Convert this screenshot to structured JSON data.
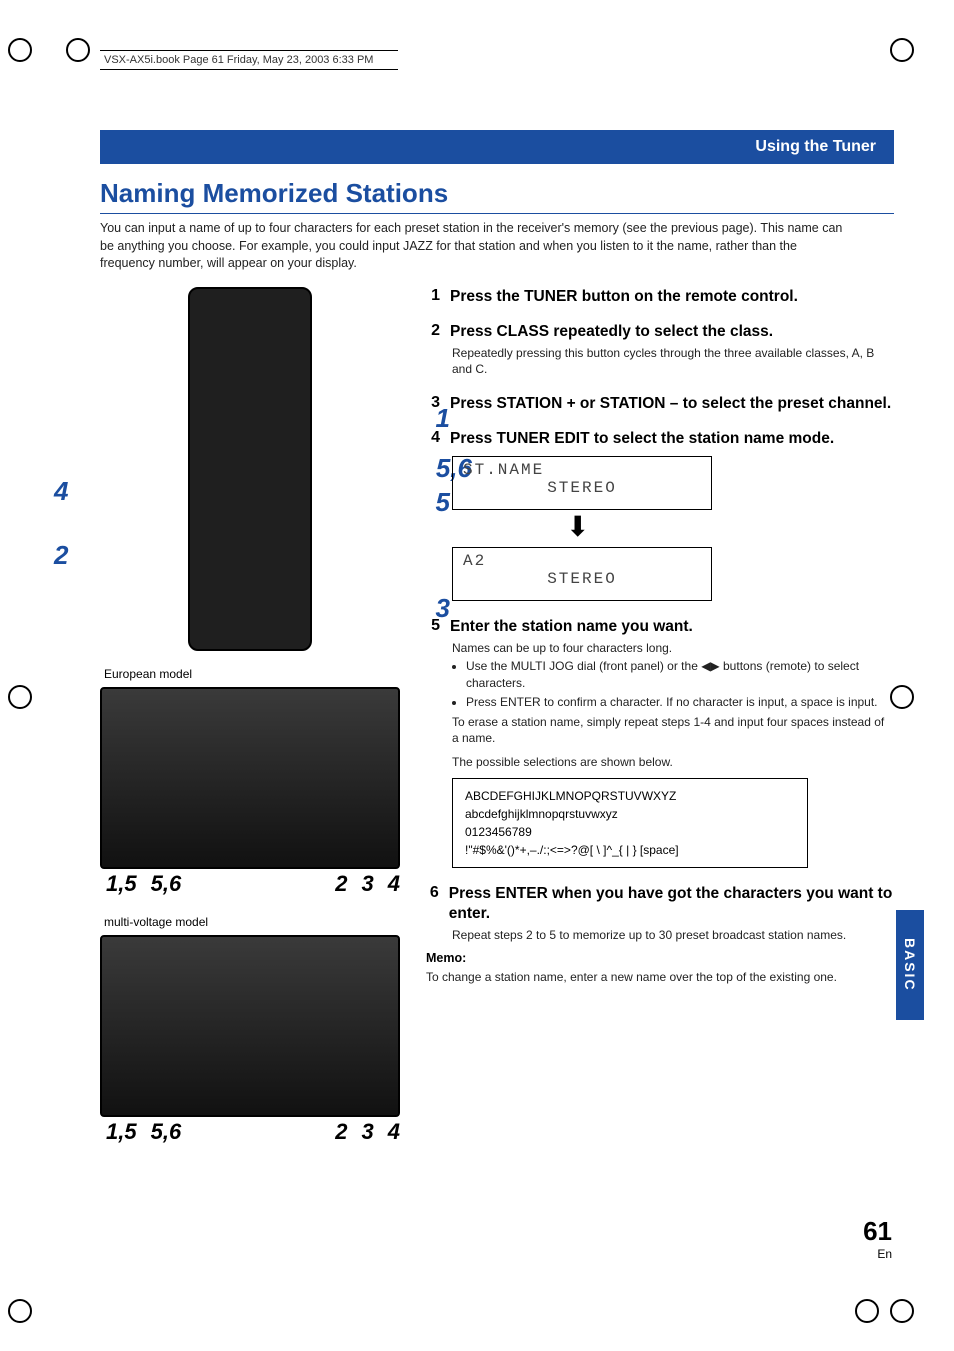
{
  "book_header": "VSX-AX5i.book  Page 61  Friday, May 23, 2003  6:33 PM",
  "chapter_bar": "Using the Tuner",
  "title": "Naming Memorized Stations",
  "intro": "You can input a name of up to four characters for each preset station in the receiver's memory (see the previous page). This name can be anything you choose. For example, you could input JAZZ for that station and when you listen to it the name, rather than the frequency number, will appear on your display.",
  "remote": {
    "callouts": {
      "c1": "1",
      "c56": "5,6",
      "c5": "5",
      "c3": "3",
      "c4": "4",
      "c2": "2"
    }
  },
  "captions": {
    "european": "European model",
    "multi": "multi-voltage model"
  },
  "panel_callouts_a": [
    "1,5",
    "5,6",
    "2",
    "3",
    "4"
  ],
  "panel_callouts_b": [
    "1,5",
    "5,6",
    "2",
    "3",
    "4"
  ],
  "steps": {
    "s1": {
      "num": "1",
      "title": "Press the TUNER button on the remote control."
    },
    "s2": {
      "num": "2",
      "title": "Press CLASS repeatedly to select the class.",
      "body": "Repeatedly pressing this button cycles through the three available classes, A, B and C."
    },
    "s3": {
      "num": "3",
      "title": "Press STATION + or STATION – to select the preset channel."
    },
    "s4": {
      "num": "4",
      "title": "Press TUNER EDIT to select the station name mode."
    },
    "display1": {
      "line1": "ST.NAME",
      "line2": "STEREO",
      "left_small": "STEREO"
    },
    "display2": {
      "line1": "A2",
      "line2": "STEREO",
      "left_small": "STEREO"
    },
    "s5": {
      "num": "5",
      "title": "Enter the station name you want.",
      "body_intro": "Names can be up to four characters long.",
      "bullet1_a": "Use the MULTI JOG dial (front panel) or the ",
      "bullet1_b": " buttons (remote) to select characters.",
      "bullet2": "Press ENTER to confirm a character. If no character is input, a space is input.",
      "body_after": "To erase a station name, simply repeat steps 1-4 and input four spaces instead of a name.",
      "body_after2": "The possible selections are shown below."
    },
    "charset": {
      "l1": "ABCDEFGHIJKLMNOPQRSTUVWXYZ",
      "l2": "abcdefghijklmnopqrstuvwxyz",
      "l3": "0123456789",
      "l4": "!\"#$%&'()*+,–./:;<=>?@[ \\ ]^_{ | } [space]"
    },
    "s6": {
      "num": "6",
      "title": "Press ENTER when you have got the characters you want to enter.",
      "body": "Repeat steps 2 to 5 to memorize up to 30 preset broadcast station names."
    },
    "memo_label": "Memo:",
    "memo_body": "To change a station name, enter a new name over the top of the existing one."
  },
  "side_tab": "BASIC",
  "footer": {
    "page": "61",
    "lang": "En"
  },
  "icons": {
    "left_right": "◀▶"
  }
}
